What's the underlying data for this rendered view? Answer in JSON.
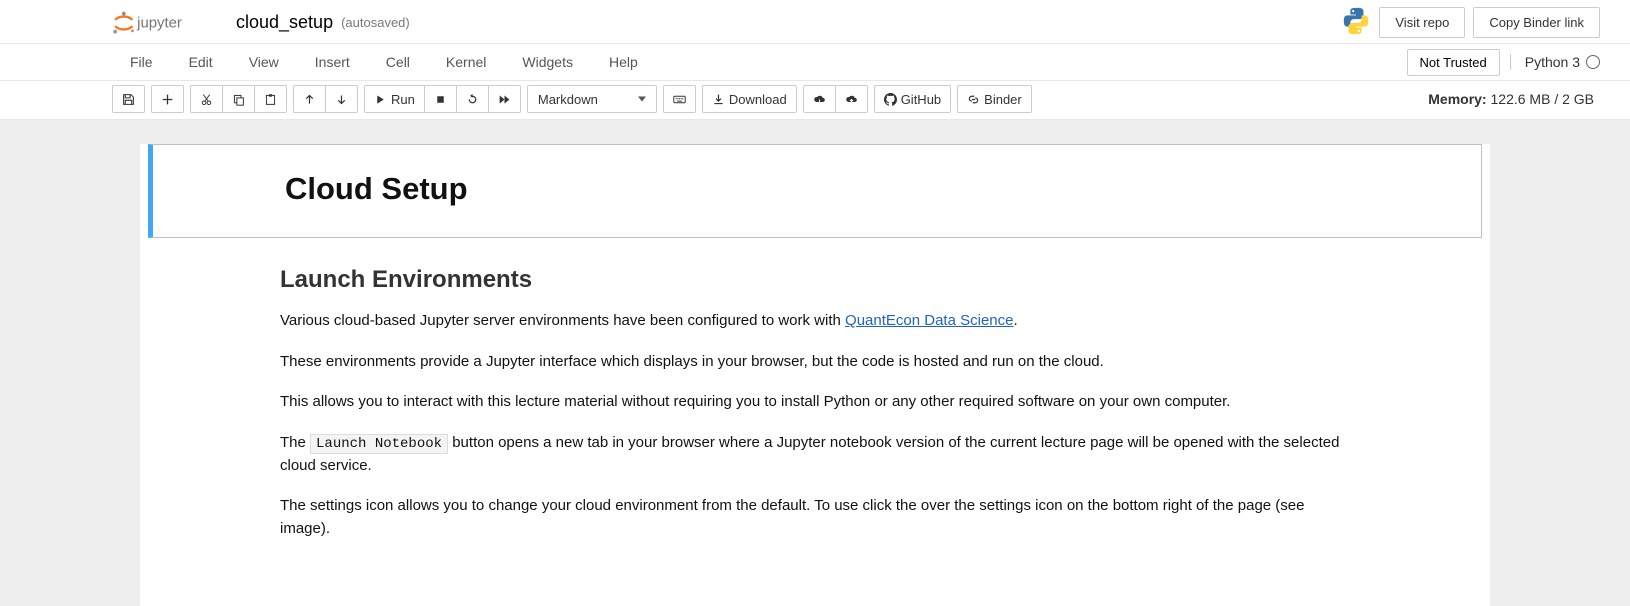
{
  "header": {
    "nb_name": "cloud_setup",
    "autosave": "(autosaved)",
    "visit_repo": "Visit repo",
    "copy_binder": "Copy Binder link"
  },
  "menubar": {
    "items": [
      "File",
      "Edit",
      "View",
      "Insert",
      "Cell",
      "Kernel",
      "Widgets",
      "Help"
    ],
    "not_trusted": "Not Trusted",
    "kernel": "Python 3"
  },
  "toolbar": {
    "run": "Run",
    "celltype": "Markdown",
    "download": "Download",
    "github": "GitHub",
    "binder": "Binder",
    "memory_label": "Memory:",
    "memory_value": "122.6 MB / 2 GB"
  },
  "cell": {
    "h1": "Cloud Setup"
  },
  "body": {
    "h2": "Launch Environments",
    "p1a": "Various cloud-based Jupyter server environments have been configured to work with ",
    "p1link": "QuantEcon Data Science",
    "p1b": ".",
    "p2": "These environments provide a Jupyter interface which displays in your browser, but the code is hosted and run on the cloud.",
    "p3": "This allows you to interact with this lecture material without requiring you to install Python or any other required software on your own computer.",
    "p4a": "The ",
    "p4code": "Launch Notebook",
    "p4b": " button opens a new tab in your browser where a Jupyter notebook version of the current lecture page will be opened with the selected cloud service.",
    "p5": "The settings icon allows you to change your cloud environment from the default. To use click the over the settings icon on the bottom right of the page (see image)."
  }
}
